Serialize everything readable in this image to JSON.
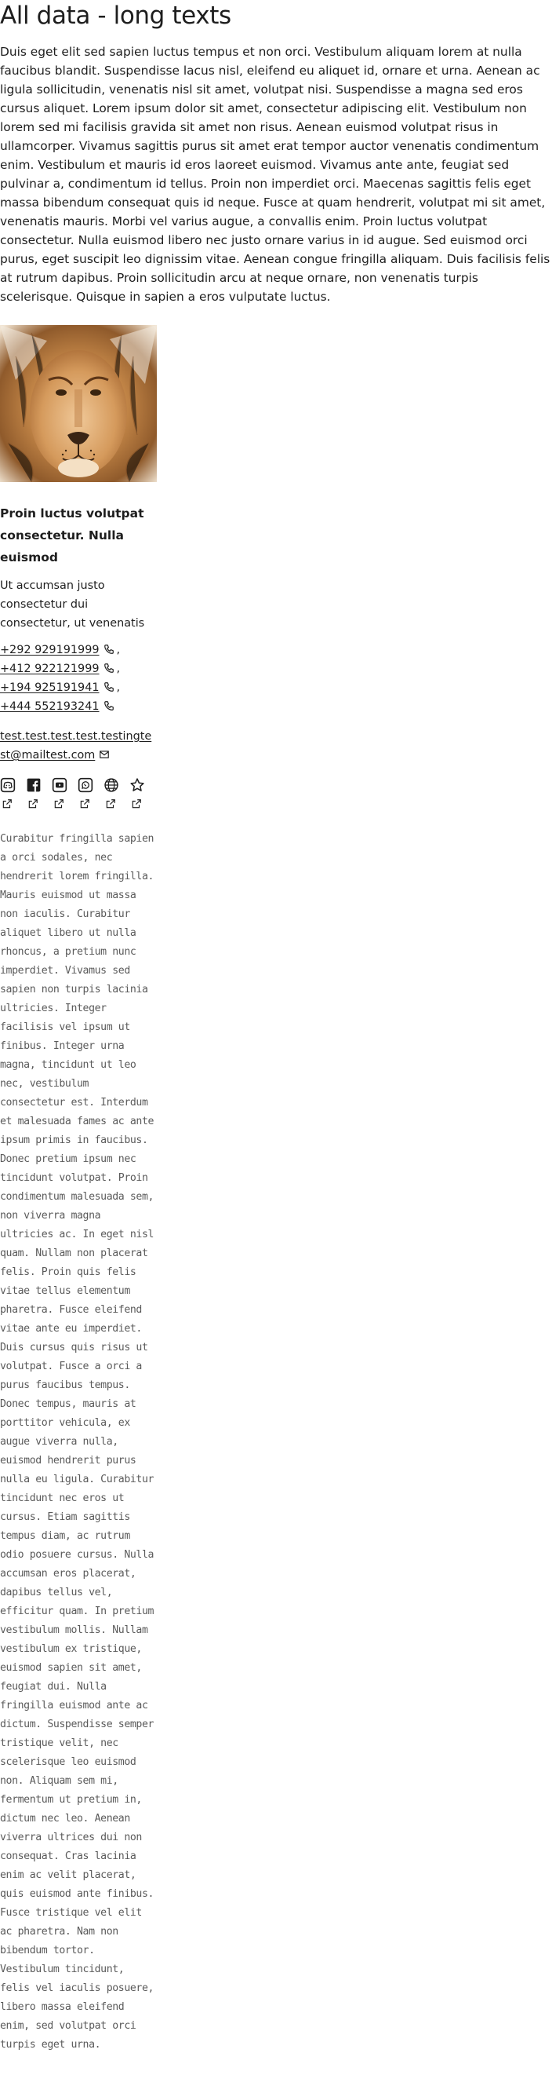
{
  "page": {
    "title": "All data - long texts",
    "intro": "Duis eget elit sed sapien luctus tempus et non orci. Vestibulum aliquam lorem at nulla faucibus blandit. Suspendisse lacus nisl, eleifend eu aliquet id, ornare et urna. Aenean ac ligula sollicitudin, venenatis nisl sit amet, volutpat nisi. Suspendisse a magna sed eros cursus aliquet. Lorem ipsum dolor sit amet, consectetur adipiscing elit. Vestibulum non lorem sed mi facilisis gravida sit amet non risus. Aenean euismod volutpat risus in ullamcorper. Vivamus sagittis purus sit amet erat tempor auctor venenatis condimentum enim. Vestibulum et mauris id eros laoreet euismod. Vivamus ante ante, feugiat sed pulvinar a, condimentum id tellus. Proin non imperdiet orci. Maecenas sagittis felis eget massa bibendum consequat quis id neque. Fusce at quam hendrerit, volutpat mi sit amet, venenatis mauris. Morbi vel varius augue, a convallis enim. Proin luctus volutpat consectetur. Nulla euismod libero nec justo ornare varius in id augue. Sed euismod orci purus, eget suscipit leo dignissim vitae. Aenean congue fringilla aliquam. Duis facilisis felis at rutrum dapibus. Proin sollicitudin arcu at neque ornare, non venenatis turpis scelerisque. Quisque in sapien a eros vulputate luctus."
  },
  "card": {
    "image_icon": "lion-photo",
    "title": "Proin luctus volutpat consectetur. Nulla euismod",
    "subtitle": "Ut accumsan justo consectetur dui consectetur, ut venenatis",
    "phones": [
      "+292 929191999",
      "+412 922121999",
      "+194 925191941",
      "+444 552193241"
    ],
    "phone_separator": ",",
    "phone_icon": "phone-icon",
    "email": "test.test.test.test.testingtest@mailtest.com",
    "email_icon": "mail-icon",
    "social_icons": [
      "discord-icon",
      "facebook-icon",
      "youtube-icon",
      "whatsapp-icon",
      "globe-icon",
      "star-icon"
    ],
    "external_icon": "external-link-icon",
    "description": "Curabitur fringilla sapien a orci sodales, nec hendrerit lorem fringilla. Mauris euismod ut massa non iaculis. Curabitur aliquet libero ut nulla rhoncus, a pretium nunc imperdiet. Vivamus sed sapien non turpis lacinia ultricies. Integer facilisis vel ipsum ut finibus. Integer urna magna, tincidunt ut leo nec, vestibulum consectetur est. Interdum et malesuada fames ac ante ipsum primis in faucibus. Donec pretium ipsum nec tincidunt volutpat. Proin condimentum malesuada sem, non viverra magna ultricies ac. In eget nisl quam. Nullam non placerat felis. Proin quis felis vitae tellus elementum pharetra. Fusce eleifend vitae ante eu imperdiet. Duis cursus quis risus ut volutpat. Fusce a orci a purus faucibus tempus. Donec tempus, mauris at porttitor vehicula, ex augue viverra nulla, euismod hendrerit purus nulla eu ligula. Curabitur tincidunt nec eros ut cursus. Etiam sagittis tempus diam, ac rutrum odio posuere cursus. Nulla accumsan eros placerat, dapibus tellus vel, efficitur quam. In pretium vestibulum mollis. Nullam vestibulum ex tristique, euismod sapien sit amet, feugiat dui. Nulla fringilla euismod ante ac dictum. Suspendisse semper tristique velit, nec scelerisque leo euismod non. Aliquam sem mi, fermentum ut pretium in, dictum nec leo. Aenean viverra ultrices dui non consequat. Cras lacinia enim ac velit placerat, quis euismod ante finibus. Fusce tristique vel elit ac pharetra. Nam non bibendum tortor. Vestibulum tincidunt, felis vel iaculis posuere, libero massa eleifend enim, sed volutpat orci turpis eget urna."
  },
  "colors": {
    "text": "#1e1e1e",
    "muted_text": "#5a5a5a",
    "background": "#ffffff"
  }
}
